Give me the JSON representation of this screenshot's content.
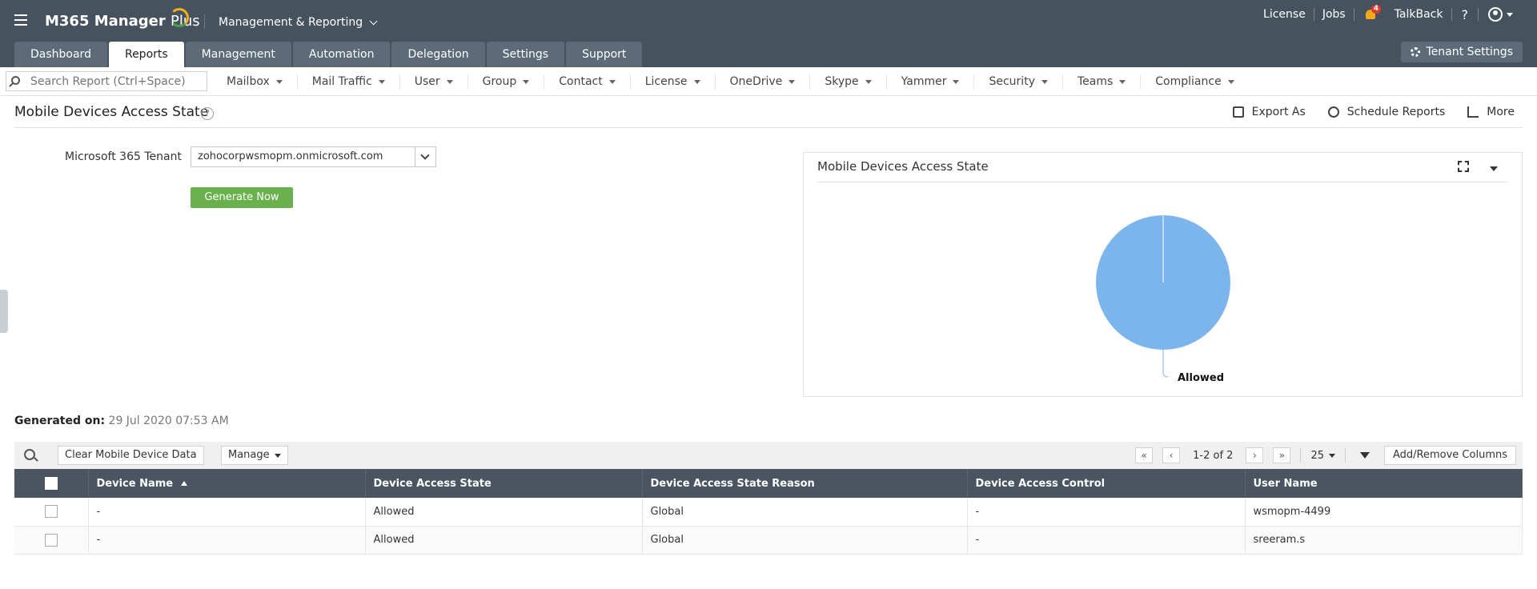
{
  "app": {
    "logo_text": "M365 Manager",
    "logo_plus": "Plus",
    "context": "Management & Reporting"
  },
  "toplinks": {
    "license": "License",
    "jobs": "Jobs",
    "notification_count": "4",
    "talkback": "TalkBack",
    "help": "?"
  },
  "tabs": [
    {
      "label": "Dashboard"
    },
    {
      "label": "Reports"
    },
    {
      "label": "Management"
    },
    {
      "label": "Automation"
    },
    {
      "label": "Delegation"
    },
    {
      "label": "Settings"
    },
    {
      "label": "Support"
    }
  ],
  "tenant_settings": "Tenant Settings",
  "search": {
    "placeholder": "Search Report (Ctrl+Space)"
  },
  "subnav": [
    {
      "label": "Mailbox"
    },
    {
      "label": "Mail Traffic"
    },
    {
      "label": "User"
    },
    {
      "label": "Group"
    },
    {
      "label": "Contact"
    },
    {
      "label": "License"
    },
    {
      "label": "OneDrive"
    },
    {
      "label": "Skype"
    },
    {
      "label": "Yammer"
    },
    {
      "label": "Security"
    },
    {
      "label": "Teams"
    },
    {
      "label": "Compliance"
    }
  ],
  "page": {
    "title": "Mobile Devices Access State",
    "help": "?",
    "export": "Export As",
    "schedule": "Schedule Reports",
    "more": "More"
  },
  "form": {
    "tenant_label": "Microsoft 365 Tenant",
    "tenant_value": "zohocorpwsmopm.onmicrosoft.com",
    "generate": "Generate Now"
  },
  "chart_panel_title": "Mobile Devices Access State",
  "chart_data": {
    "type": "pie",
    "categories": [
      "Allowed"
    ],
    "values": [
      2
    ],
    "colors": [
      "#7cb5ec"
    ],
    "labels": [
      "Allowed"
    ]
  },
  "generated": {
    "label": "Generated on:",
    "value": "29 Jul 2020 07:53 AM"
  },
  "grid_toolbar": {
    "clear": "Clear Mobile Device Data",
    "manage": "Manage",
    "page_info": "1-2 of 2",
    "page_size": "25",
    "add_remove": "Add/Remove Columns"
  },
  "table": {
    "headers": [
      "Device Name",
      "Device Access State",
      "Device Access State Reason",
      "Device Access Control",
      "User Name"
    ],
    "rows": [
      [
        "-",
        "Allowed",
        "Global",
        "-",
        "wsmopm-4499"
      ],
      [
        "-",
        "Allowed",
        "Global",
        "-",
        "sreeram.s"
      ]
    ]
  }
}
